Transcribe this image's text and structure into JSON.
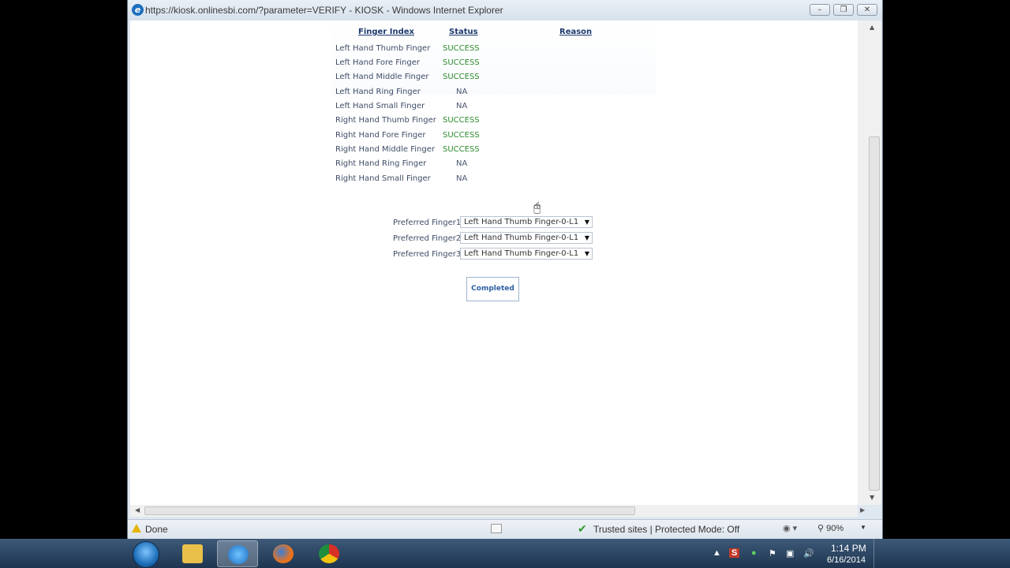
{
  "window": {
    "title": "https://kiosk.onlinesbi.com/?parameter=VERIFY - KIOSK - Windows Internet Explorer",
    "buttons": [
      "minimize",
      "restore",
      "close"
    ]
  },
  "table": {
    "headers": {
      "finger_index": "Finger Index",
      "status": "Status",
      "reason": "Reason"
    },
    "rows": [
      {
        "finger": "Left Hand Thumb Finger",
        "status": "SUCCESS"
      },
      {
        "finger": "Left Hand Fore Finger",
        "status": "SUCCESS"
      },
      {
        "finger": "Left Hand Middle Finger",
        "status": "SUCCESS"
      },
      {
        "finger": "Left Hand Ring Finger",
        "status": "NA"
      },
      {
        "finger": "Left Hand Small Finger",
        "status": "NA"
      },
      {
        "finger": "Right Hand Thumb Finger",
        "status": "SUCCESS"
      },
      {
        "finger": "Right Hand Fore Finger",
        "status": "SUCCESS"
      },
      {
        "finger": "Right Hand Middle Finger",
        "status": "SUCCESS"
      },
      {
        "finger": "Right Hand Ring Finger",
        "status": "NA"
      },
      {
        "finger": "Right Hand Small Finger",
        "status": "NA"
      }
    ]
  },
  "preferred": [
    {
      "label": "Preferred Finger1",
      "value": "Left Hand Thumb Finger-0-L1"
    },
    {
      "label": "Preferred Finger2",
      "value": "Left Hand Thumb Finger-0-L1"
    },
    {
      "label": "Preferred Finger3",
      "value": "Left Hand Thumb Finger-0-L1"
    }
  ],
  "completed_label": "Completed",
  "statusbar": {
    "done": "Done",
    "zone": "Trusted sites | Protected Mode: Off",
    "zoom": "90%"
  },
  "taskbar": {
    "time": "1:14 PM",
    "date": "6/16/2014"
  },
  "colors": {
    "success": "#2e8b2e",
    "header": "#1f3a6e"
  }
}
